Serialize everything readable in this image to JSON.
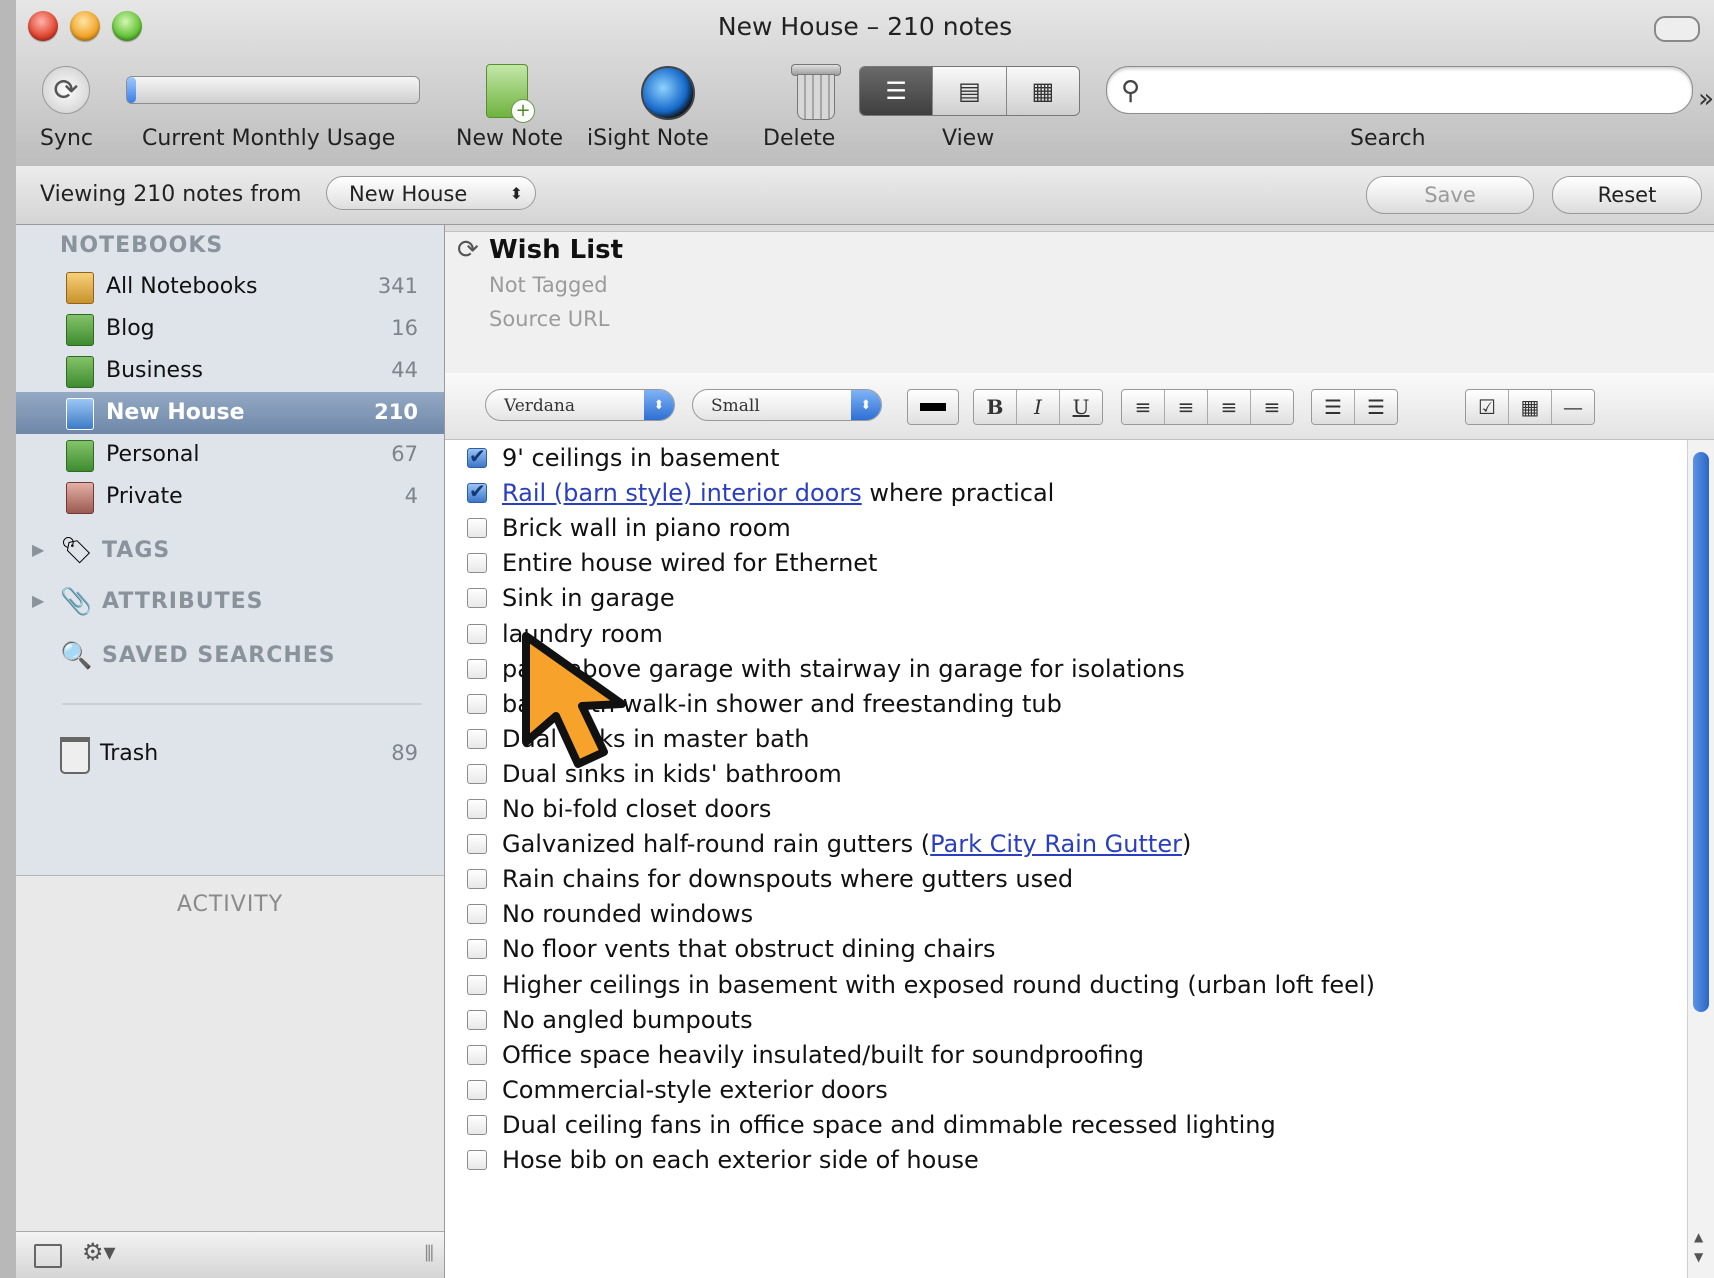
{
  "window": {
    "title": "New House – 210 notes"
  },
  "toolbar": {
    "sync_label": "Sync",
    "usage_label": "Current Monthly Usage",
    "usage_fraction": 0.03,
    "new_note_label": "New Note",
    "isight_label": "iSight Note",
    "delete_label": "Delete",
    "view_label": "View",
    "search_label": "Search",
    "search_value": "",
    "overflow": "»"
  },
  "viewbar": {
    "viewing_label": "Viewing 210 notes from",
    "notebook_selected": "New House",
    "save_label": "Save",
    "reset_label": "Reset"
  },
  "sidebar": {
    "notebooks_heading": "NOTEBOOKS",
    "notebooks": [
      {
        "name": "All Notebooks",
        "count": "341"
      },
      {
        "name": "Blog",
        "count": "16"
      },
      {
        "name": "Business",
        "count": "44"
      },
      {
        "name": "New House",
        "count": "210"
      },
      {
        "name": "Personal",
        "count": "67"
      },
      {
        "name": "Private",
        "count": "4"
      }
    ],
    "tags_label": "TAGS",
    "attributes_label": "ATTRIBUTES",
    "saved_searches_label": "SAVED SEARCHES",
    "trash": {
      "name": "Trash",
      "count": "89"
    },
    "activity_label": "ACTIVITY"
  },
  "note": {
    "title": "Wish List",
    "tags": "Not Tagged",
    "source_url": "Source URL",
    "font": "Verdana",
    "size": "Small",
    "format_buttons": {
      "bold": "B",
      "italic": "I",
      "underline": "U"
    },
    "items": [
      {
        "text": "9' ceilings in basement",
        "checked": true
      },
      {
        "link": "Rail (barn style) interior doors",
        "after": " where practical",
        "checked": true
      },
      {
        "text": "Brick wall in piano room",
        "checked": false
      },
      {
        "text": "Entire house wired for Ethernet",
        "checked": false
      },
      {
        "text": "Sink in garage",
        "checked": false
      },
      {
        "text": "laundry room",
        "checked": false
      },
      {
        "text": "pace above garage with stairway in garage for isolations",
        "checked": false
      },
      {
        "text": "bath with walk-in shower and freestanding tub",
        "checked": false
      },
      {
        "text": "Dual sinks in master bath",
        "checked": false
      },
      {
        "text": "Dual sinks in kids' bathroom",
        "checked": false
      },
      {
        "text": "No bi-fold closet doors",
        "checked": false
      },
      {
        "text": "Galvanized half-round rain gutters (",
        "link": "Park City Rain Gutter",
        "after": ")",
        "checked": false
      },
      {
        "text": "Rain chains for downspouts where gutters used",
        "checked": false
      },
      {
        "text": "No rounded windows",
        "checked": false
      },
      {
        "text": "No floor vents that obstruct dining chairs",
        "checked": false
      },
      {
        "text": "Higher ceilings in basement with exposed round ducting (urban loft feel)",
        "checked": false
      },
      {
        "text": "No angled bumpouts",
        "checked": false
      },
      {
        "text": "Office space heavily insulated/built for soundproofing",
        "checked": false
      },
      {
        "text": "Commercial-style exterior doors",
        "checked": false
      },
      {
        "text": "Dual ceiling fans in office space and dimmable recessed lighting",
        "checked": false
      },
      {
        "text": "Hose bib on each exterior side of house",
        "checked": false
      }
    ]
  },
  "colors": {
    "accent": "#3d76c9",
    "cursor": "#f7a22a",
    "selection": "#7f96b6",
    "link": "#2a3fbf"
  }
}
